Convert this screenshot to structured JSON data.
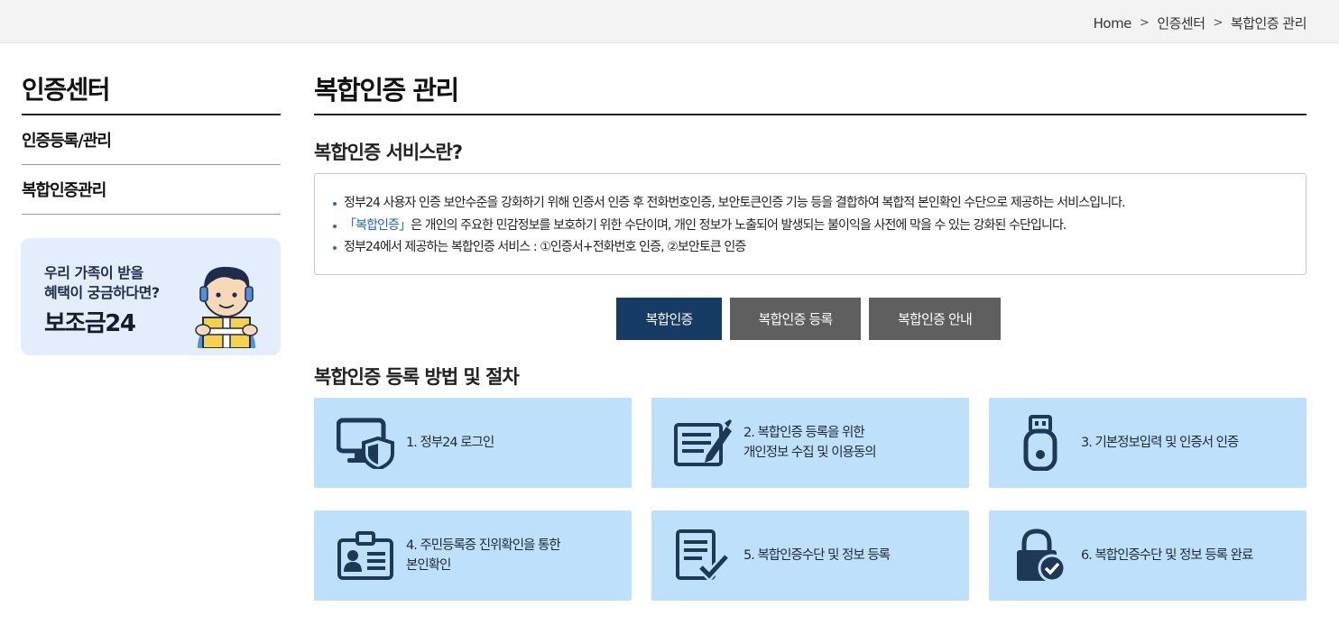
{
  "breadcrumb": {
    "home": "Home",
    "level1": "인증센터",
    "level2": "복합인증 관리",
    "separator": ">"
  },
  "sidebar": {
    "title": "인증센터",
    "items": [
      {
        "label": "인증등록/관리"
      },
      {
        "label": "복합인증관리"
      }
    ],
    "banner": {
      "line1": "우리 가족이 받을",
      "line2": "혜택이 궁금하다면?",
      "brand": "보조금24"
    }
  },
  "main": {
    "title": "복합인증 관리",
    "intro_heading": "복합인증 서비스란?",
    "info": {
      "item1": "정부24 사용자 인증 보안수준을 강화하기 위해 인증서 인증 후 전화번호인증, 보안토큰인증 기능 등을 결합하여 복합적 본인확인 수단으로 제공하는 서비스입니다.",
      "item2_highlight": "「복합인증」",
      "item2_rest": "은 개인의 주요한 민감정보를 보호하기 위한 수단이며, 개인 정보가 노출되어 발생되는 불이익을 사전에 막을 수 있는 강화된 수단입니다.",
      "item3": "정부24에서 제공하는 복합인증 서비스 : ①인증서+전화번호 인증, ②보안토큰 인증"
    },
    "tabs": [
      {
        "label": "복합인증",
        "active": true
      },
      {
        "label": "복합인증 등록",
        "active": false
      },
      {
        "label": "복합인증 안내",
        "active": false
      }
    ],
    "steps_heading": "복합인증 등록 방법 및 절차",
    "steps": [
      {
        "line1": "1. 정부24 로그인",
        "line2": "",
        "icon": "monitor-shield-icon"
      },
      {
        "line1": "2. 복합인증 등록을 위한",
        "line2": "개인정보 수집 및 이용동의",
        "icon": "form-edit-icon"
      },
      {
        "line1": "3. 기본정보입력 및 인증서 인증",
        "line2": "",
        "icon": "usb-token-icon"
      },
      {
        "line1": "4. 주민등록증 진위확인을 통한",
        "line2": "본인확인",
        "icon": "id-card-icon"
      },
      {
        "line1": "5. 복합인증수단 및 정보 등록",
        "line2": "",
        "icon": "document-check-icon"
      },
      {
        "line1": "6. 복합인증수단 및 정보 등록 완료",
        "line2": "",
        "icon": "lock-check-icon"
      }
    ]
  },
  "colors": {
    "navy": "#163b64",
    "tab_gray": "#5f5f5f",
    "step_bg": "#bfe0fa",
    "icon": "#1e3957",
    "highlight": "#1d66c9"
  }
}
